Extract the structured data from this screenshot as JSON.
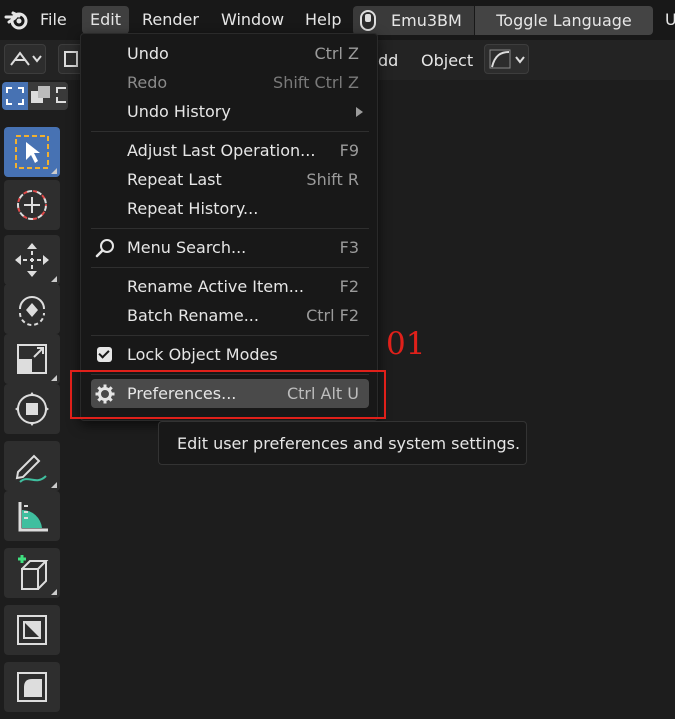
{
  "menubar": {
    "items": [
      {
        "label": "File"
      },
      {
        "label": "Edit"
      },
      {
        "label": "Render"
      },
      {
        "label": "Window"
      },
      {
        "label": "Help"
      }
    ],
    "workspace_emu": "Emu3BM",
    "workspace_toggle": "Toggle Language",
    "cut_tab": "U"
  },
  "header": {
    "add_label": "dd",
    "object_label": "Object"
  },
  "edit_menu": {
    "items": [
      {
        "label": "Undo",
        "shortcut": "Ctrl Z"
      },
      {
        "label": "Redo",
        "shortcut": "Shift Ctrl Z"
      },
      {
        "label": "Undo History",
        "shortcut": ""
      },
      {
        "label": "Adjust Last Operation...",
        "shortcut": "F9"
      },
      {
        "label": "Repeat Last",
        "shortcut": "Shift R"
      },
      {
        "label": "Repeat History...",
        "shortcut": ""
      },
      {
        "label": "Menu Search...",
        "shortcut": "F3"
      },
      {
        "label": "Rename Active Item...",
        "shortcut": "F2"
      },
      {
        "label": "Batch Rename...",
        "shortcut": "Ctrl F2"
      },
      {
        "label": "Lock Object Modes",
        "shortcut": ""
      },
      {
        "label": "Preferences...",
        "shortcut": "Ctrl Alt U"
      }
    ]
  },
  "annotation": {
    "step_number": "01",
    "color": "#e0201a"
  },
  "tooltip": {
    "text": "Edit user preferences and system settings."
  },
  "colors": {
    "accent": "#4772b3",
    "menu_bg": "#181818",
    "highlight": "#4a4a4a"
  }
}
